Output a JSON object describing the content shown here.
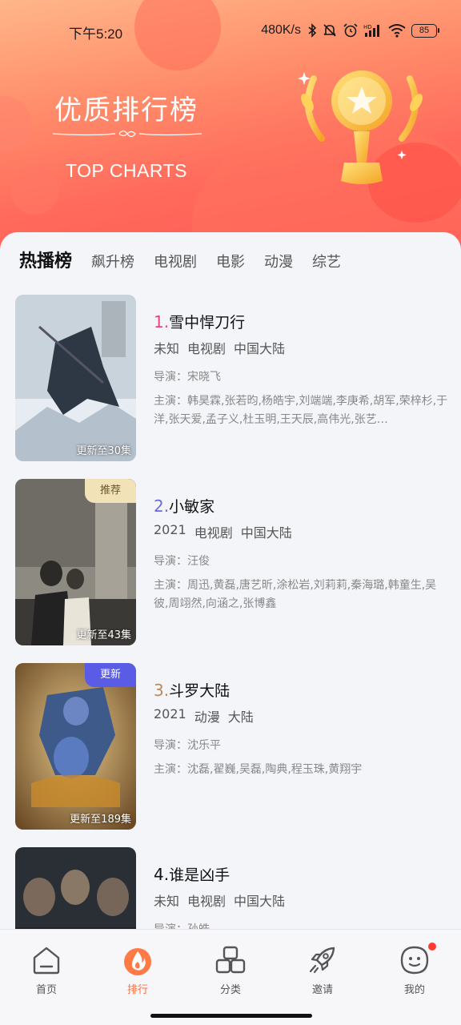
{
  "status_bar": {
    "time": "下午5:20",
    "network_speed": "480K/s",
    "icons": [
      "bluetooth-icon",
      "mute-icon",
      "alarm-icon",
      "hd-signal-icon",
      "wifi-icon"
    ],
    "battery": "85"
  },
  "header": {
    "title": "优质排行榜",
    "subtitle": "TOP CHARTS",
    "decoration": "trophy-icon"
  },
  "tabs": [
    {
      "label": "热播榜",
      "active": true
    },
    {
      "label": "飙升榜",
      "active": false
    },
    {
      "label": "电视剧",
      "active": false
    },
    {
      "label": "电影",
      "active": false
    },
    {
      "label": "动漫",
      "active": false
    },
    {
      "label": "综艺",
      "active": false
    }
  ],
  "items": [
    {
      "rank": "1.",
      "title": "雪中悍刀行",
      "year": "未知",
      "type": "电视剧",
      "region": "中国大陆",
      "director": "导演：宋晓飞",
      "cast": "主演：韩昊霖,张若昀,杨皓宇,刘端端,李庚希,胡军,荣梓杉,于洋,张天爱,孟子义,杜玉明,王天辰,高伟光,张艺…",
      "episode": "更新至30集",
      "tag": "",
      "rank_color": "#e8467c"
    },
    {
      "rank": "2.",
      "title": "小敏家",
      "year": "2021",
      "type": "电视剧",
      "region": "中国大陆",
      "director": "导演：汪俊",
      "cast": "主演：周迅,黄磊,唐艺昕,涂松岩,刘莉莉,秦海璐,韩童生,吴彼,周翊然,向涵之,张博鑫",
      "episode": "更新至43集",
      "tag": "推荐",
      "rank_color": "#6b6bd8"
    },
    {
      "rank": "3.",
      "title": "斗罗大陆",
      "year": "2021",
      "type": "动漫",
      "region": "大陆",
      "director": "导演：沈乐平",
      "cast": "主演：沈磊,翟巍,吴磊,陶典,程玉珠,黄翔宇",
      "episode": "更新至189集",
      "tag": "更新",
      "rank_color": "#b98a5a"
    },
    {
      "rank": "4.",
      "title": "谁是凶手",
      "year": "未知",
      "type": "电视剧",
      "region": "中国大陆",
      "director": "导演：孙皓",
      "cast": "",
      "episode": "",
      "tag": "",
      "rank_color": "#111111"
    }
  ],
  "bottom_nav": [
    {
      "label": "首页",
      "icon": "home-icon",
      "active": false
    },
    {
      "label": "排行",
      "icon": "flame-icon",
      "active": true
    },
    {
      "label": "分类",
      "icon": "category-icon",
      "active": false
    },
    {
      "label": "邀请",
      "icon": "rocket-icon",
      "active": false
    },
    {
      "label": "我的",
      "icon": "profile-icon",
      "active": false,
      "badge": true
    }
  ],
  "colors": {
    "accent": "#ff6b3d",
    "hero_gradient_start": "#ffb689",
    "hero_gradient_end": "#ff5a55",
    "tag_recommend": "#f2e2b8",
    "tag_update": "#5b5ce6"
  }
}
